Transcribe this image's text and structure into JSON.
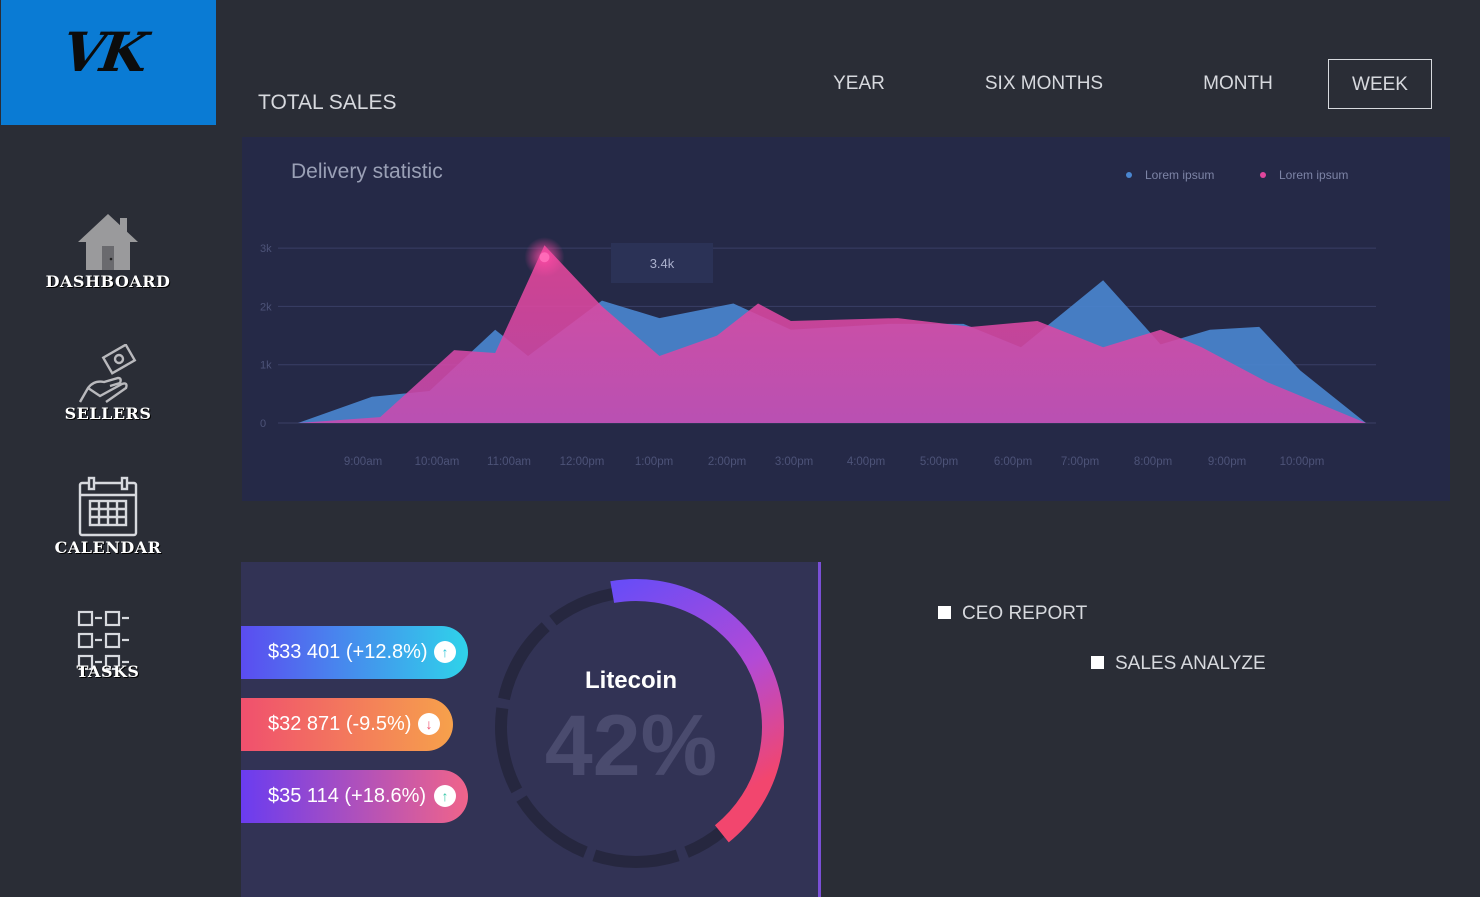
{
  "logo": {
    "text": "VK"
  },
  "sidebar": {
    "items": [
      {
        "label": "DASHBOARD",
        "icon": "house-icon"
      },
      {
        "label": "SELLERS",
        "icon": "hand-money-icon"
      },
      {
        "label": "CALENDAR",
        "icon": "calendar-icon"
      },
      {
        "label": "TASKS",
        "icon": "task-list-icon"
      }
    ]
  },
  "header": {
    "title": "TOTAL SALES",
    "ranges": [
      "YEAR",
      "SIX MONTHS",
      "MONTH",
      "WEEK"
    ],
    "active_range": "WEEK"
  },
  "chart_data": {
    "type": "area",
    "title": "Delivery statistic",
    "xlabel": "",
    "ylabel": "",
    "categories": [
      "9:00am",
      "10:00am",
      "11:00am",
      "12:00pm",
      "1:00pm",
      "2:00pm",
      "3:00pm",
      "4:00pm",
      "5:00pm",
      "6:00pm",
      "7:00pm",
      "8:00pm",
      "9:00pm",
      "10:00pm"
    ],
    "y_ticks": [
      "0",
      "1k",
      "2k",
      "3k"
    ],
    "ylim": [
      0,
      3.5
    ],
    "grid": true,
    "legend_position": "top-right",
    "tooltip": {
      "label": "3.4k",
      "series": 1,
      "x": 3.0,
      "y": 3.05
    },
    "series": [
      {
        "name": "Lorem ipsum",
        "color": "#4a86d0",
        "points": [
          [
            0,
            0
          ],
          [
            0.9,
            0.45
          ],
          [
            1.6,
            0.55
          ],
          [
            2.4,
            1.6
          ],
          [
            2.8,
            1.15
          ],
          [
            3.7,
            2.1
          ],
          [
            4.4,
            1.8
          ],
          [
            5.3,
            2.05
          ],
          [
            6.0,
            1.6
          ],
          [
            7.2,
            1.7
          ],
          [
            8.1,
            1.7
          ],
          [
            8.8,
            1.3
          ],
          [
            9.8,
            2.45
          ],
          [
            10.5,
            1.35
          ],
          [
            11.1,
            1.6
          ],
          [
            11.7,
            1.65
          ],
          [
            12.2,
            0.9
          ],
          [
            13.0,
            0
          ]
        ]
      },
      {
        "name": "Lorem ipsum",
        "color": "#e0469c",
        "points": [
          [
            0,
            0
          ],
          [
            1.0,
            0.1
          ],
          [
            1.9,
            1.25
          ],
          [
            2.4,
            1.2
          ],
          [
            3.0,
            3.05
          ],
          [
            3.7,
            2.0
          ],
          [
            4.4,
            1.15
          ],
          [
            5.1,
            1.5
          ],
          [
            5.6,
            2.05
          ],
          [
            6.0,
            1.75
          ],
          [
            7.3,
            1.8
          ],
          [
            8.2,
            1.65
          ],
          [
            9.0,
            1.75
          ],
          [
            9.8,
            1.3
          ],
          [
            10.5,
            1.6
          ],
          [
            11.0,
            1.3
          ],
          [
            11.8,
            0.7
          ],
          [
            13.0,
            0
          ]
        ]
      }
    ]
  },
  "crypto": {
    "name": "Litecoin",
    "percent_label": "42%",
    "percent": 42,
    "prices": [
      {
        "label": "$33 401 (+12.8%)",
        "direction": "up",
        "color_from": "#5b4cf0",
        "color_to": "#2fd3ea",
        "icon_color": "#2fc5d6"
      },
      {
        "label": "$32 871 (-9.5%)",
        "direction": "down",
        "color_from": "#f0506e",
        "color_to": "#f6a14b",
        "icon_color": "#f0506e"
      },
      {
        "label": "$35 114 (+18.6%)",
        "direction": "up",
        "color_from": "#6a3cf0",
        "color_to": "#f0648a",
        "icon_color": "#36c7a8"
      }
    ]
  },
  "reports": [
    {
      "label": "CEO REPORT"
    },
    {
      "label": "SALES ANALYZE"
    }
  ],
  "colors": {
    "background": "#2a2d36",
    "logo_bg": "#0a7bd4",
    "chart_bg": "#252947",
    "crypto_bg": "#323355"
  }
}
